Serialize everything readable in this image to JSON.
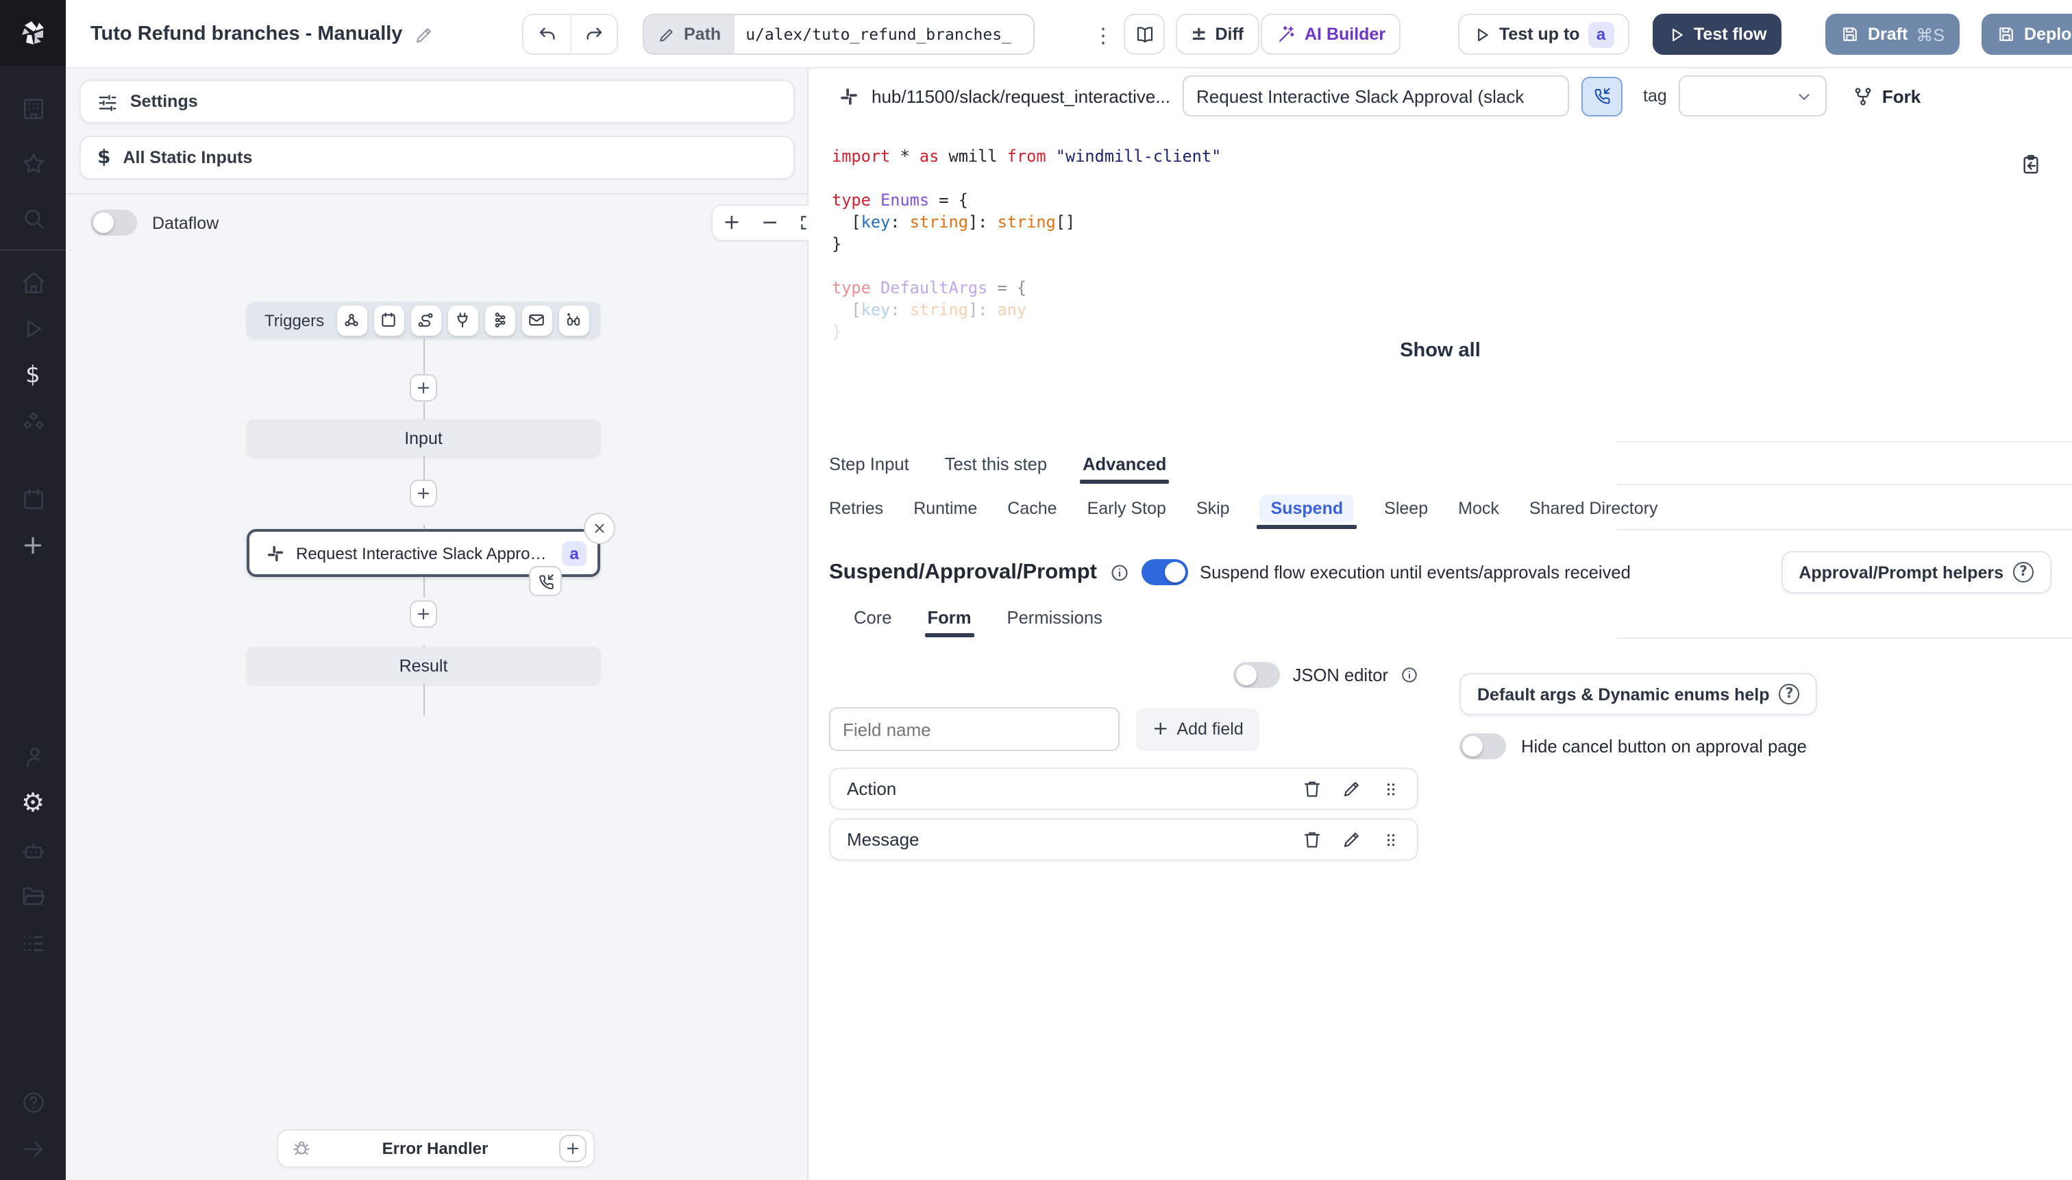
{
  "glyphs": {
    "kebab": "⋮",
    "plus": "+",
    "minus": "−",
    "dollar": "$",
    "gear": "⚙",
    "plusminus": "±",
    "question": "?"
  },
  "topbar": {
    "title": "Tuto Refund branches - Manually",
    "path_label": "Path",
    "path_value": "u/alex/tuto_refund_branches_",
    "diff": "Diff",
    "ai_builder": "AI Builder",
    "test_up_to": "Test up to",
    "test_badge": "a",
    "test_flow": "Test flow",
    "draft": "Draft",
    "draft_shortcut": "⌘S",
    "deploy": "Deploy"
  },
  "left": {
    "settings": "Settings",
    "all_static_inputs": "All Static Inputs",
    "dataflow": "Dataflow",
    "triggers": "Triggers",
    "input": "Input",
    "node_label": "Request Interactive Slack Approval (...",
    "node_badge": "a",
    "result": "Result",
    "error_handler": "Error Handler"
  },
  "right": {
    "hub_path": "hub/11500/slack/request_interactive...",
    "script_name": "Request Interactive Slack Approval (slack",
    "tag_label": "tag",
    "fork": "Fork",
    "show_all": "Show all",
    "tabs": [
      {
        "label": "Step Input"
      },
      {
        "label": "Test this step"
      },
      {
        "label": "Advanced"
      }
    ],
    "subtabs": [
      {
        "label": "Retries"
      },
      {
        "label": "Runtime"
      },
      {
        "label": "Cache"
      },
      {
        "label": "Early Stop"
      },
      {
        "label": "Skip"
      },
      {
        "label": "Suspend"
      },
      {
        "label": "Sleep"
      },
      {
        "label": "Mock"
      },
      {
        "label": "Shared Directory"
      }
    ],
    "suspend": {
      "heading": "Suspend/Approval/Prompt",
      "toggle_label": "Suspend flow execution until events/approvals received",
      "helpers": "Approval/Prompt helpers",
      "tabs": [
        {
          "label": "Core"
        },
        {
          "label": "Form"
        },
        {
          "label": "Permissions"
        }
      ],
      "json_editor": "JSON editor",
      "field_placeholder": "Field name",
      "add_field": "Add field",
      "fields": [
        {
          "name": "Action"
        },
        {
          "name": "Message"
        }
      ],
      "default_args_help": "Default args & Dynamic enums help",
      "hide_cancel": "Hide cancel button on approval page"
    }
  },
  "code": {
    "lines": [
      {
        "fade": 1,
        "tokens": [
          [
            "import",
            "k"
          ],
          [
            " * ",
            "p"
          ],
          [
            "as",
            "k"
          ],
          [
            " wmill ",
            "p"
          ],
          [
            "from",
            "k"
          ],
          [
            " \"windmill-client\"",
            "s"
          ]
        ]
      },
      {
        "fade": 1,
        "tokens": []
      },
      {
        "fade": 1,
        "tokens": [
          [
            "type",
            "k"
          ],
          [
            " Enums",
            "t"
          ],
          [
            " = {",
            "p"
          ]
        ]
      },
      {
        "fade": 1,
        "tokens": [
          [
            "  [",
            "p"
          ],
          [
            "key",
            "v"
          ],
          [
            ": ",
            "p"
          ],
          [
            "string",
            "o"
          ],
          [
            "]: ",
            "p"
          ],
          [
            "string",
            "o"
          ],
          [
            "[]",
            "p"
          ]
        ]
      },
      {
        "fade": 1,
        "tokens": [
          [
            "}",
            "p"
          ]
        ]
      },
      {
        "fade": 1,
        "tokens": []
      },
      {
        "fade": 0.5,
        "tokens": [
          [
            "type",
            "k"
          ],
          [
            " DefaultArgs",
            "t"
          ],
          [
            " = {",
            "p"
          ]
        ]
      },
      {
        "fade": 0.32,
        "tokens": [
          [
            "  [",
            "p"
          ],
          [
            "key",
            "v"
          ],
          [
            ": ",
            "p"
          ],
          [
            "string",
            "o"
          ],
          [
            "]: ",
            "p"
          ],
          [
            "any",
            "o"
          ]
        ]
      },
      {
        "fade": 0.13,
        "tokens": [
          [
            "}",
            "p"
          ]
        ]
      }
    ]
  },
  "colors": {
    "accent_blue": "#2e68dd",
    "navy": "#35425f",
    "slate": "#7089ab",
    "purple": "#6d35c8",
    "rail": "#1e2127"
  }
}
